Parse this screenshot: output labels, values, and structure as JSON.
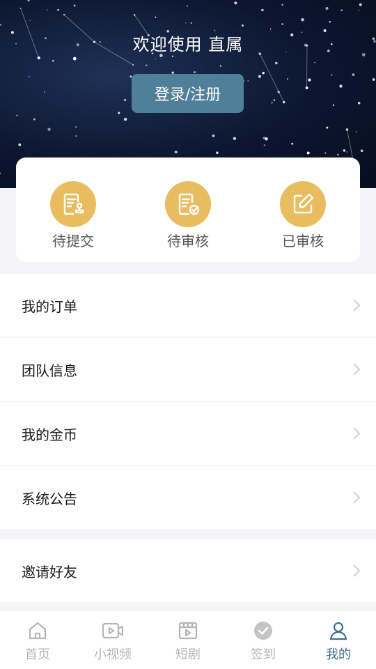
{
  "header": {
    "welcome": "欢迎使用 直属",
    "login_label": "登录/注册"
  },
  "status": [
    {
      "label": "待提交",
      "icon": "document-stamp-icon"
    },
    {
      "label": "待审核",
      "icon": "document-check-icon"
    },
    {
      "label": "已审核",
      "icon": "edit-icon"
    }
  ],
  "menu": [
    {
      "label": "我的订单"
    },
    {
      "label": "团队信息"
    },
    {
      "label": "我的金币"
    },
    {
      "label": "系统公告"
    },
    {
      "label": "邀请好友"
    }
  ],
  "tabs": [
    {
      "label": "首页",
      "icon": "home-icon",
      "active": false
    },
    {
      "label": "小视频",
      "icon": "video-icon",
      "active": false
    },
    {
      "label": "短剧",
      "icon": "film-icon",
      "active": false
    },
    {
      "label": "签到",
      "icon": "check-circle-icon",
      "active": false
    },
    {
      "label": "我的",
      "icon": "user-icon",
      "active": true
    }
  ],
  "colors": {
    "accent": "#3f6f8c",
    "status_circle": "#e9bd5f",
    "login_button": "#4f7f99"
  }
}
